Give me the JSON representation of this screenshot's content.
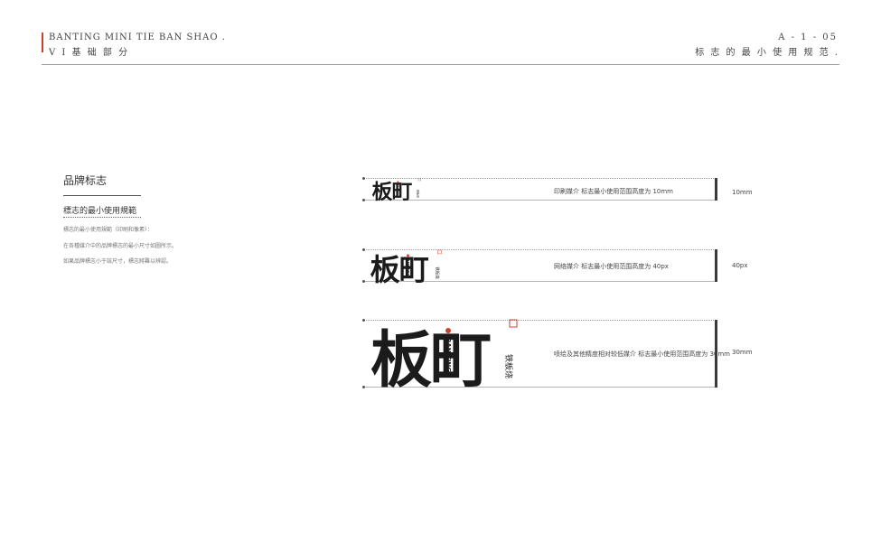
{
  "header": {
    "brand_line": "BANTING MINI TIE BAN SHAO .",
    "section_line": "V I 基 础 部 分",
    "page_code": "A - 1 - 05",
    "page_title": "标 志 的 最 小 使 用 规 范 ."
  },
  "sidebar": {
    "title": "品牌标志",
    "subtitle": "標志的最小使用規範",
    "descriptions": [
      "標志的最小使用規範（印刷和像素）：",
      "在各種媒介中的品牌標志的最小尺寸如圖所示。",
      "如果品牌標志小于該尺寸，標志將難以辨認。"
    ]
  },
  "logo": {
    "mark": "板町",
    "romanization": "BAN TING",
    "tagline": "铁板烧",
    "ink_color": "#1b1b1b",
    "accent_color": "#c8412f"
  },
  "rows": [
    {
      "note": "印刷媒介 标志最小使用范围高度为 10mm",
      "size_label": "10mm"
    },
    {
      "note": "网络媒介 标志最小使用范围高度为 40px",
      "size_label": "40px"
    },
    {
      "note": "喷绘及其他精度相对较低媒介 标志最小使用范围高度为 30mm",
      "size_label": "30mm"
    }
  ]
}
